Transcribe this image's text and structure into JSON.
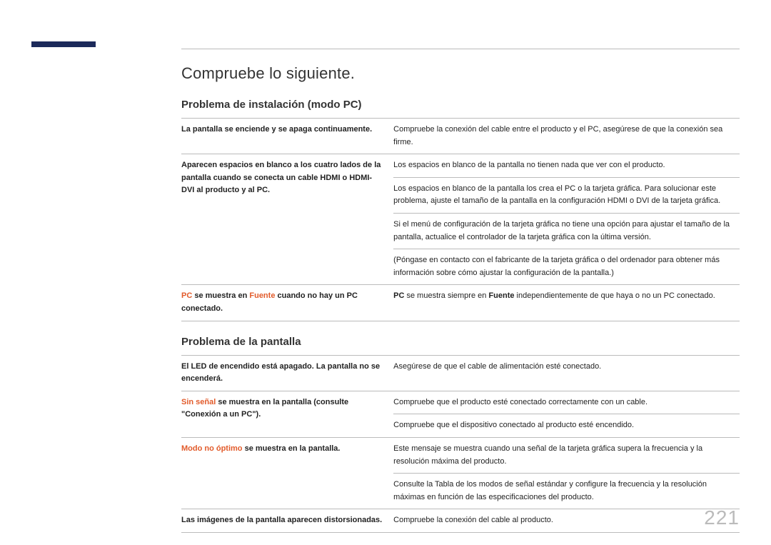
{
  "pageNumber": "221",
  "title": "Compruebe lo siguiente.",
  "sections": [
    {
      "heading": "Problema de instalación (modo PC)",
      "rows": [
        {
          "left": [
            {
              "t": "La pantalla se enciende y se apaga continuamente."
            }
          ],
          "right": [
            [
              {
                "t": "Compruebe la conexión del cable entre el producto y el PC, asegúrese de que la conexión sea firme."
              }
            ]
          ]
        },
        {
          "left": [
            {
              "t": "Aparecen espacios en blanco a los cuatro lados de la pantalla cuando se conecta un cable HDMI o HDMI-DVI al producto y al PC."
            }
          ],
          "right": [
            [
              {
                "t": "Los espacios en blanco de la pantalla no tienen nada que ver con el producto."
              }
            ],
            [
              {
                "t": "Los espacios en blanco de la pantalla los crea el PC o la tarjeta gráfica. Para solucionar este problema, ajuste el tamaño de la pantalla en la configuración HDMI o DVI de la tarjeta gráfica."
              }
            ],
            [
              {
                "t": "Si el menú de configuración de la tarjeta gráfica no tiene una opción para ajustar el tamaño de la pantalla, actualice el controlador de la tarjeta gráfica con la última versión."
              }
            ],
            [
              {
                "t": "(Póngase en contacto con el fabricante de la tarjeta gráfica o del ordenador para obtener más información sobre cómo ajustar la configuración de la pantalla.)"
              }
            ]
          ]
        },
        {
          "left": [
            {
              "t": "PC",
              "c": "hl"
            },
            {
              "t": " se muestra en "
            },
            {
              "t": "Fuente",
              "c": "hl"
            },
            {
              "t": " cuando no hay un PC conectado."
            }
          ],
          "right": [
            [
              {
                "t": "PC",
                "c": "hl-n bold"
              },
              {
                "t": " se muestra siempre en "
              },
              {
                "t": "Fuente",
                "c": "hl-n bold"
              },
              {
                "t": " independientemente de que haya o no un PC conectado."
              }
            ]
          ]
        }
      ]
    },
    {
      "heading": "Problema de la pantalla",
      "rows": [
        {
          "left": [
            {
              "t": "El LED de encendido está apagado. La pantalla no se encenderá."
            }
          ],
          "right": [
            [
              {
                "t": "Asegúrese de que el cable de alimentación esté conectado."
              }
            ]
          ]
        },
        {
          "left": [
            {
              "t": "Sin señal",
              "c": "hl"
            },
            {
              "t": " se muestra en la pantalla (consulte \"Conexión a un PC\")."
            }
          ],
          "right": [
            [
              {
                "t": "Compruebe que el producto esté conectado correctamente con un cable."
              }
            ],
            [
              {
                "t": "Compruebe que el dispositivo conectado al producto esté encendido."
              }
            ]
          ]
        },
        {
          "left": [
            {
              "t": "Modo no óptimo",
              "c": "hl"
            },
            {
              "t": " se muestra en la pantalla."
            }
          ],
          "right": [
            [
              {
                "t": "Este mensaje se muestra cuando una señal de la tarjeta gráfica supera la frecuencia y la resolución máxima del producto."
              }
            ],
            [
              {
                "t": "Consulte la Tabla de los modos de señal estándar y configure la frecuencia y la resolución máximas en función de las especificaciones del producto."
              }
            ]
          ]
        },
        {
          "left": [
            {
              "t": "Las imágenes de la pantalla aparecen distorsionadas."
            }
          ],
          "right": [
            [
              {
                "t": "Compruebe la conexión del cable al producto."
              }
            ]
          ]
        }
      ]
    }
  ]
}
